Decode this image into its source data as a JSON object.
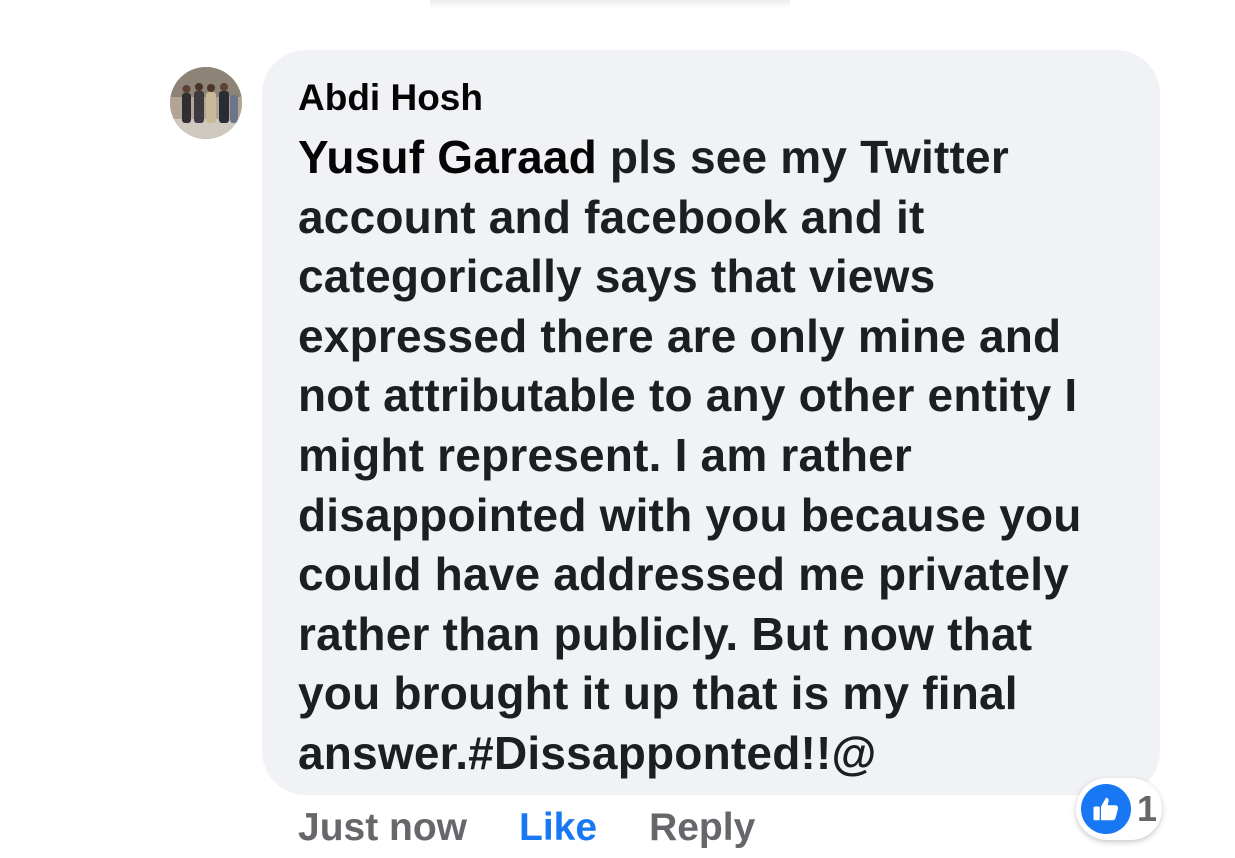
{
  "comment": {
    "author": "Abdi Hosh",
    "mention": "Yusuf Garaad",
    "text_lines": [
      " pls see my Twitter",
      "account and facebook and it",
      "categorically says that views",
      "expressed there are only mine and",
      "not attributable to any other entity I",
      "might represent. I am rather",
      "disappointed with you because you",
      "could have addressed me privately",
      "rather than publicly.  But now that",
      "you brought it up that is my final",
      "answer.#Dissapponted!!@"
    ],
    "avatar_icon": "profile-photo-group"
  },
  "actions": {
    "timestamp": "Just now",
    "like_label": "Like",
    "reply_label": "Reply"
  },
  "reactions": {
    "icon": "thumbs-up-icon",
    "count": "1"
  },
  "colors": {
    "bubble": "#f0f2f5",
    "like_blue": "#1877f2",
    "muted_text": "#65676b",
    "text": "#050505"
  }
}
